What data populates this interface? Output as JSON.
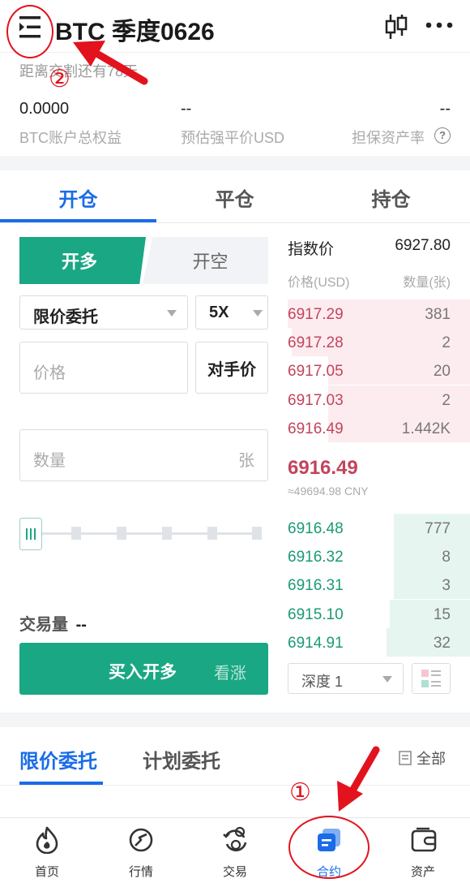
{
  "header": {
    "title": "BTC 季度0626",
    "delivery_text": "距离交割还有78天"
  },
  "account": {
    "equity_value": "0.0000",
    "equity_label": "BTC账户总权益",
    "liq_value": "--",
    "liq_label": "预估强平价USD",
    "margin_value": "--",
    "margin_label": "担保资产率"
  },
  "tabs": [
    {
      "label": "开仓",
      "active": true
    },
    {
      "label": "平仓",
      "active": false
    },
    {
      "label": "持仓",
      "active": false
    }
  ],
  "form": {
    "long_label": "开多",
    "short_label": "开空",
    "order_type": "限价委托",
    "leverage": "5X",
    "price_placeholder": "价格",
    "counterparty_label": "对手价",
    "qty_placeholder": "数量",
    "qty_unit": "张",
    "volume_label": "交易量",
    "volume_value": "--",
    "buy_label": "买入开多",
    "buy_sub": "看涨",
    "slider_ratio": 0
  },
  "orderbook": {
    "index_label": "指数价",
    "index_value": "6927.80",
    "price_col": "价格(USD)",
    "qty_col": "数量(张)",
    "asks": [
      {
        "price": "6917.29",
        "qty": "381",
        "depth": 1.0
      },
      {
        "price": "6917.28",
        "qty": "2",
        "depth": 0.98
      },
      {
        "price": "6917.05",
        "qty": "20",
        "depth": 0.78
      },
      {
        "price": "6917.03",
        "qty": "2",
        "depth": 0.78
      },
      {
        "price": "6916.49",
        "qty": "1.442K",
        "depth": 0.78
      }
    ],
    "last_price": "6916.49",
    "last_price_cny": "≈49694.98 CNY",
    "bids": [
      {
        "price": "6916.48",
        "qty": "777",
        "depth": 0.42
      },
      {
        "price": "6916.32",
        "qty": "8",
        "depth": 0.42
      },
      {
        "price": "6916.31",
        "qty": "3",
        "depth": 0.42
      },
      {
        "price": "6915.10",
        "qty": "15",
        "depth": 0.44
      },
      {
        "price": "6914.91",
        "qty": "32",
        "depth": 0.46
      }
    ],
    "depth_label": "深度 1"
  },
  "orders": {
    "tab_limit": "限价委托",
    "tab_plan": "计划委托",
    "all_label": "全部"
  },
  "nav": [
    {
      "label": "首页",
      "icon": "home-flame-icon",
      "active": false
    },
    {
      "label": "行情",
      "icon": "market-icon",
      "active": false
    },
    {
      "label": "交易",
      "icon": "trade-icon",
      "active": false
    },
    {
      "label": "合约",
      "icon": "contract-icon",
      "active": true
    },
    {
      "label": "资产",
      "icon": "wallet-icon",
      "active": false
    }
  ],
  "annotations": {
    "marker_1": "①",
    "marker_2": "②"
  },
  "colors": {
    "accent": "#1a6ce8",
    "buy": "#1aa784",
    "ask_red": "#c2445c",
    "annotation_red": "#e2131d"
  }
}
